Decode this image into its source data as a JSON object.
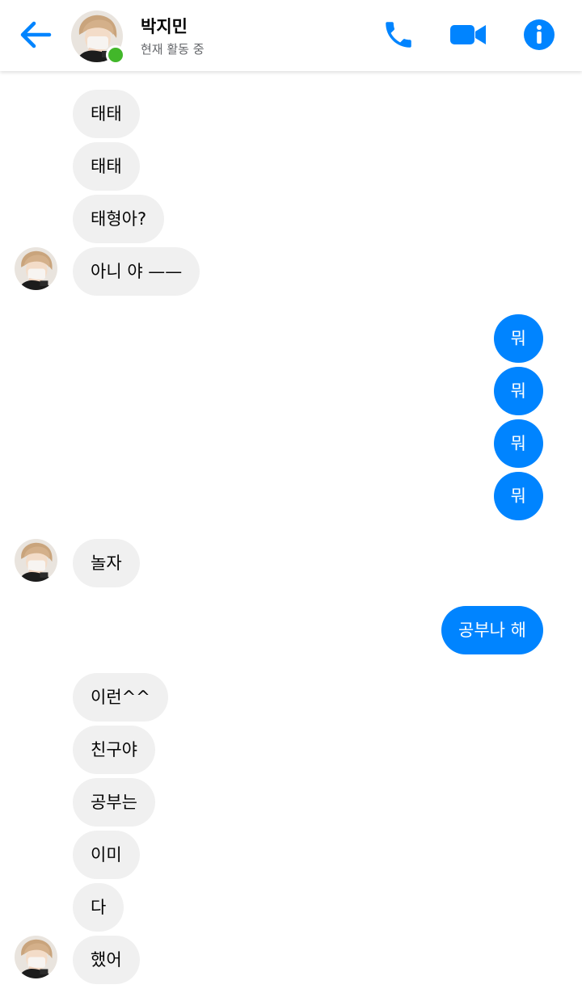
{
  "header": {
    "name": "박지민",
    "status": "현재 활동 중"
  },
  "colors": {
    "accent": "#0084ff",
    "presence": "#42b72a",
    "incoming_bubble": "#f0f0f0",
    "outgoing_bubble": "#0084ff"
  },
  "icons": {
    "back": "back-arrow-icon",
    "call": "phone-icon",
    "video": "video-camera-icon",
    "info": "info-icon"
  },
  "messages": [
    {
      "side": "in",
      "text": "태태"
    },
    {
      "side": "in",
      "text": "태태"
    },
    {
      "side": "in",
      "text": "태형아?"
    },
    {
      "side": "in",
      "text": "아니 야 ——"
    },
    {
      "side": "out",
      "text": "뭐"
    },
    {
      "side": "out",
      "text": "뭐"
    },
    {
      "side": "out",
      "text": "뭐"
    },
    {
      "side": "out",
      "text": "뭐"
    },
    {
      "side": "in",
      "text": "놀자"
    },
    {
      "side": "out",
      "text": "공부나 해"
    },
    {
      "side": "in",
      "text": "이런^^"
    },
    {
      "side": "in",
      "text": "친구야"
    },
    {
      "side": "in",
      "text": "공부는"
    },
    {
      "side": "in",
      "text": "이미"
    },
    {
      "side": "in",
      "text": "다"
    },
    {
      "side": "in",
      "text": "했어"
    }
  ]
}
